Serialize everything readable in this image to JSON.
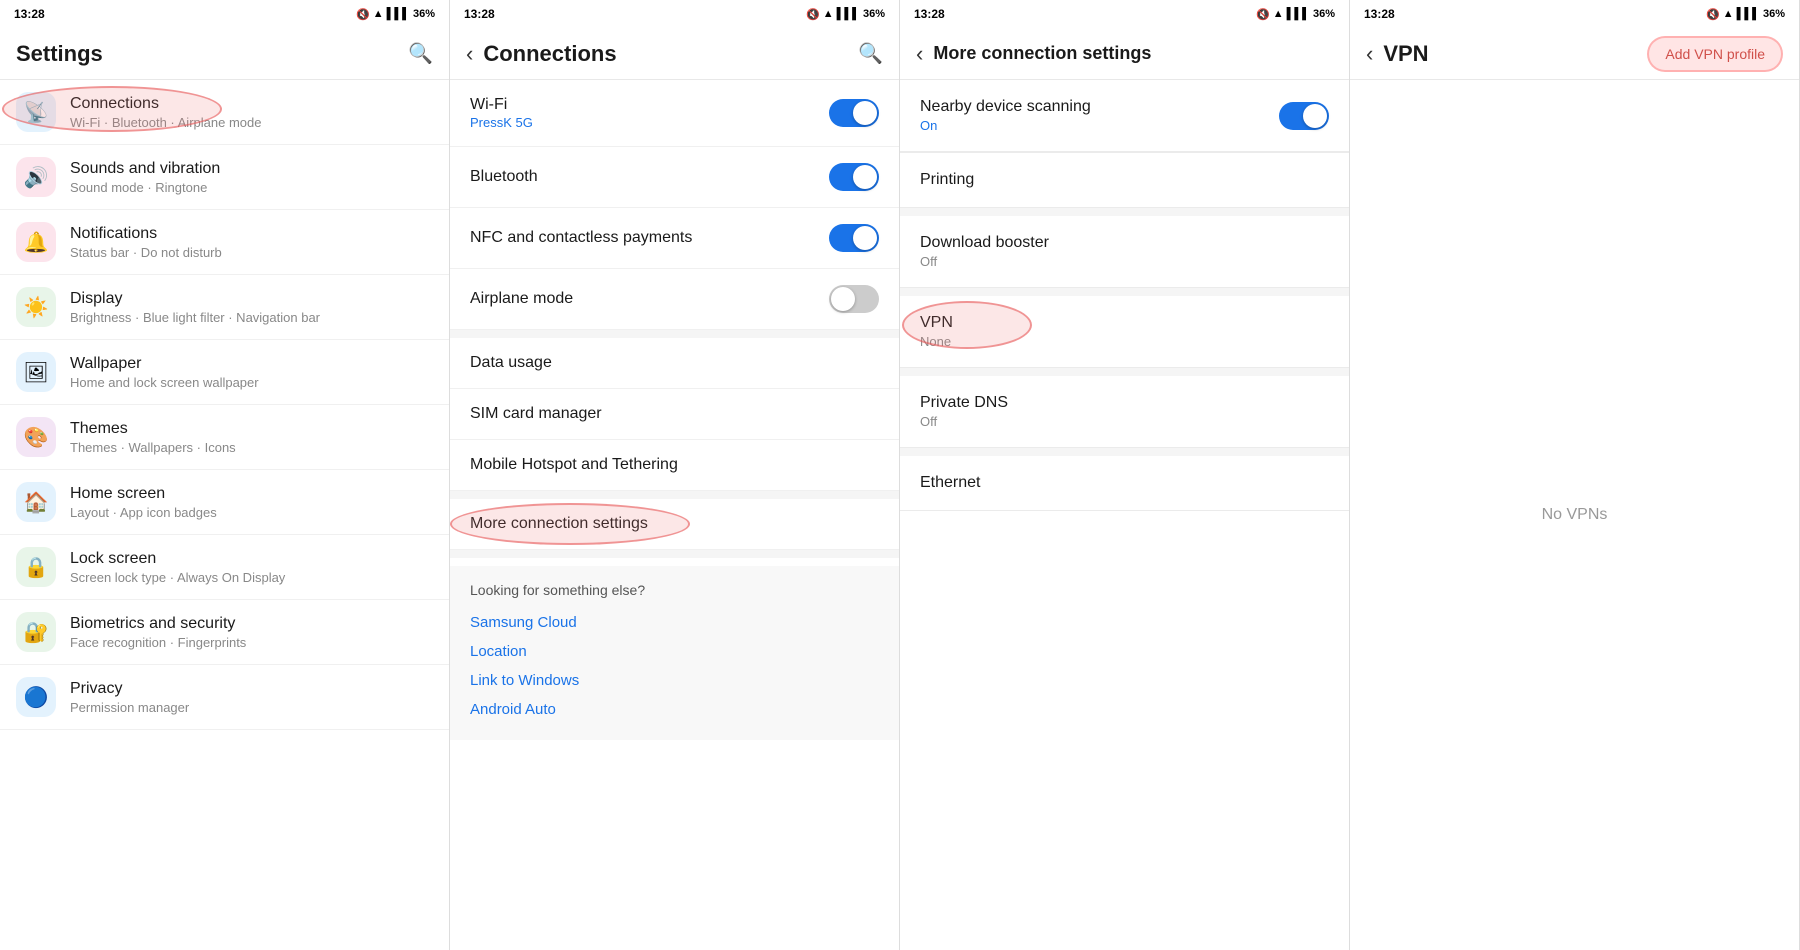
{
  "panels": [
    {
      "id": "settings",
      "statusTime": "13:28",
      "title": "Settings",
      "showBack": false,
      "showSearch": true,
      "items": [
        {
          "id": "connections",
          "icon": "📡",
          "iconBg": "#e3f2fd",
          "title": "Connections",
          "subtitle": "Wi-Fi · Bluetooth · Airplane mode",
          "highlighted": true
        },
        {
          "id": "sounds",
          "icon": "🔊",
          "iconBg": "#fce4ec",
          "title": "Sounds and vibration",
          "subtitle": "Sound mode · Ringtone"
        },
        {
          "id": "notifications",
          "icon": "🔔",
          "iconBg": "#fce4ec",
          "title": "Notifications",
          "subtitle": "Status bar · Do not disturb"
        },
        {
          "id": "display",
          "icon": "☀️",
          "iconBg": "#e8f5e9",
          "title": "Display",
          "subtitle": "Brightness · Blue light filter · Navigation bar"
        },
        {
          "id": "wallpaper",
          "icon": "🖼",
          "iconBg": "#e3f2fd",
          "title": "Wallpaper",
          "subtitle": "Home and lock screen wallpaper"
        },
        {
          "id": "themes",
          "icon": "🎨",
          "iconBg": "#f3e5f5",
          "title": "Themes",
          "subtitle": "Themes · Wallpapers · Icons"
        },
        {
          "id": "homescreen",
          "icon": "🏠",
          "iconBg": "#e3f2fd",
          "title": "Home screen",
          "subtitle": "Layout · App icon badges"
        },
        {
          "id": "lockscreen",
          "icon": "🔒",
          "iconBg": "#e8f5e9",
          "title": "Lock screen",
          "subtitle": "Screen lock type · Always On Display"
        },
        {
          "id": "biometrics",
          "icon": "🔐",
          "iconBg": "#e8f5e9",
          "title": "Biometrics and security",
          "subtitle": "Face recognition · Fingerprints"
        },
        {
          "id": "privacy",
          "icon": "🔵",
          "iconBg": "#e3f2fd",
          "title": "Privacy",
          "subtitle": "Permission manager"
        }
      ]
    },
    {
      "id": "connections",
      "statusTime": "13:28",
      "title": "Connections",
      "showBack": true,
      "showSearch": true,
      "toggleItems": [
        {
          "id": "wifi",
          "title": "Wi-Fi",
          "subtitle": "PressK 5G",
          "hasToggle": true,
          "toggleOn": true
        },
        {
          "id": "bluetooth",
          "title": "Bluetooth",
          "subtitle": "",
          "hasToggle": true,
          "toggleOn": true
        },
        {
          "id": "nfc",
          "title": "NFC and contactless payments",
          "subtitle": "",
          "hasToggle": true,
          "toggleOn": true
        },
        {
          "id": "airplane",
          "title": "Airplane mode",
          "subtitle": "",
          "hasToggle": true,
          "toggleOn": false
        }
      ],
      "plainItems": [
        {
          "id": "datausage",
          "title": "Data usage",
          "subtitle": ""
        },
        {
          "id": "simcard",
          "title": "SIM card manager",
          "subtitle": ""
        },
        {
          "id": "hotspot",
          "title": "Mobile Hotspot and Tethering",
          "subtitle": ""
        }
      ],
      "moreItem": {
        "id": "more",
        "title": "More connection settings",
        "highlighted": true
      },
      "lookingSection": {
        "heading": "Looking for something else?",
        "links": [
          "Samsung Cloud",
          "Location",
          "Link to Windows",
          "Android Auto"
        ]
      }
    },
    {
      "id": "more-connections",
      "statusTime": "13:28",
      "title": "More connection settings",
      "showBack": true,
      "showSearch": false,
      "items": [
        {
          "id": "nearby",
          "title": "Nearby device scanning",
          "subtitle": "On",
          "hasToggle": true,
          "toggleOn": true
        },
        {
          "id": "printing",
          "title": "Printing",
          "subtitle": "",
          "hasToggle": false
        },
        {
          "id": "dlbooster",
          "title": "Download booster",
          "subtitle": "Off",
          "hasToggle": false
        },
        {
          "id": "vpn",
          "title": "VPN",
          "subtitle": "None",
          "hasToggle": false,
          "highlighted": true
        },
        {
          "id": "privatedns",
          "title": "Private DNS",
          "subtitle": "Off",
          "hasToggle": false
        },
        {
          "id": "ethernet",
          "title": "Ethernet",
          "subtitle": "",
          "hasToggle": false
        }
      ]
    },
    {
      "id": "vpn",
      "statusTime": "13:28",
      "title": "VPN",
      "showBack": true,
      "showSearch": false,
      "addBtnLabel": "Add VPN profile",
      "noVpnText": "No VPNs"
    }
  ],
  "icons": {
    "search": "🔍",
    "back": "‹",
    "battery": "36%",
    "wifi_signal": "📶",
    "signal": "📶"
  }
}
